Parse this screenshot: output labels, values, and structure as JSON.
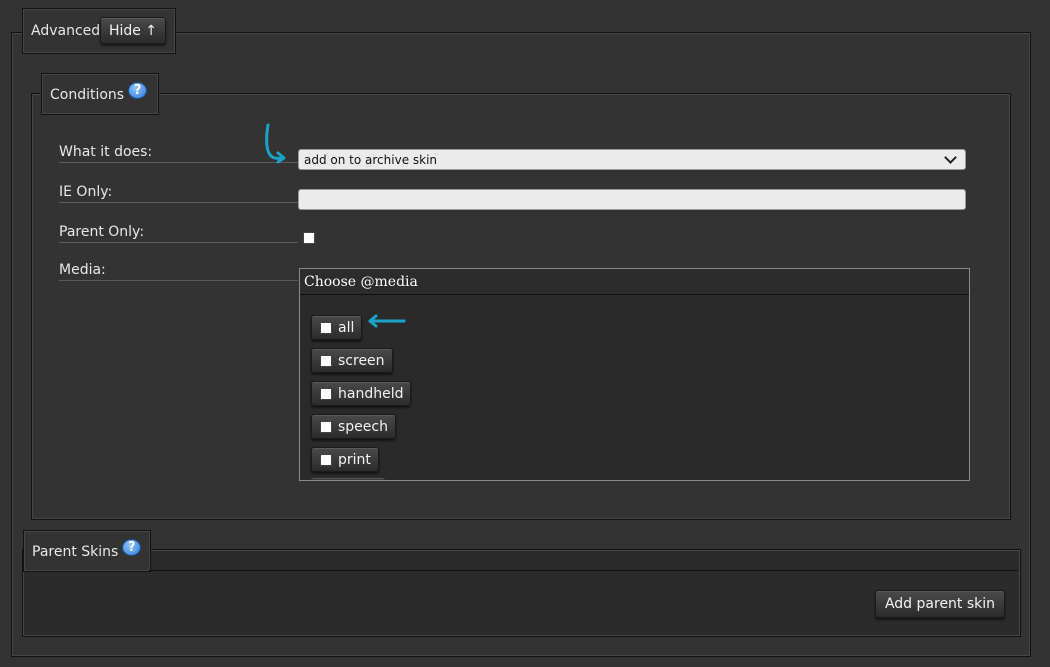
{
  "advanced": {
    "legend": "Advanced",
    "hide_button": "Hide ↑"
  },
  "conditions": {
    "legend": "Conditions",
    "help": "?",
    "fields": {
      "what_it_does_label": "What it does:",
      "what_it_does_value": "add on to archive skin",
      "ie_only_label": "IE Only:",
      "ie_only_value": "",
      "parent_only_label": "Parent Only:",
      "parent_only_checked": false,
      "media_label": "Media:"
    },
    "media": {
      "title": "Choose @media",
      "options": [
        {
          "label": "all",
          "checked": false
        },
        {
          "label": "screen",
          "checked": false
        },
        {
          "label": "handheld",
          "checked": false
        },
        {
          "label": "speech",
          "checked": false
        },
        {
          "label": "print",
          "checked": false
        }
      ]
    }
  },
  "parent_skins": {
    "legend": "Parent Skins",
    "help": "?",
    "add_button": "Add parent skin"
  },
  "colors": {
    "background": "#333333",
    "annotation": "#1aa3c9",
    "help_icon": "#3a8be8"
  }
}
